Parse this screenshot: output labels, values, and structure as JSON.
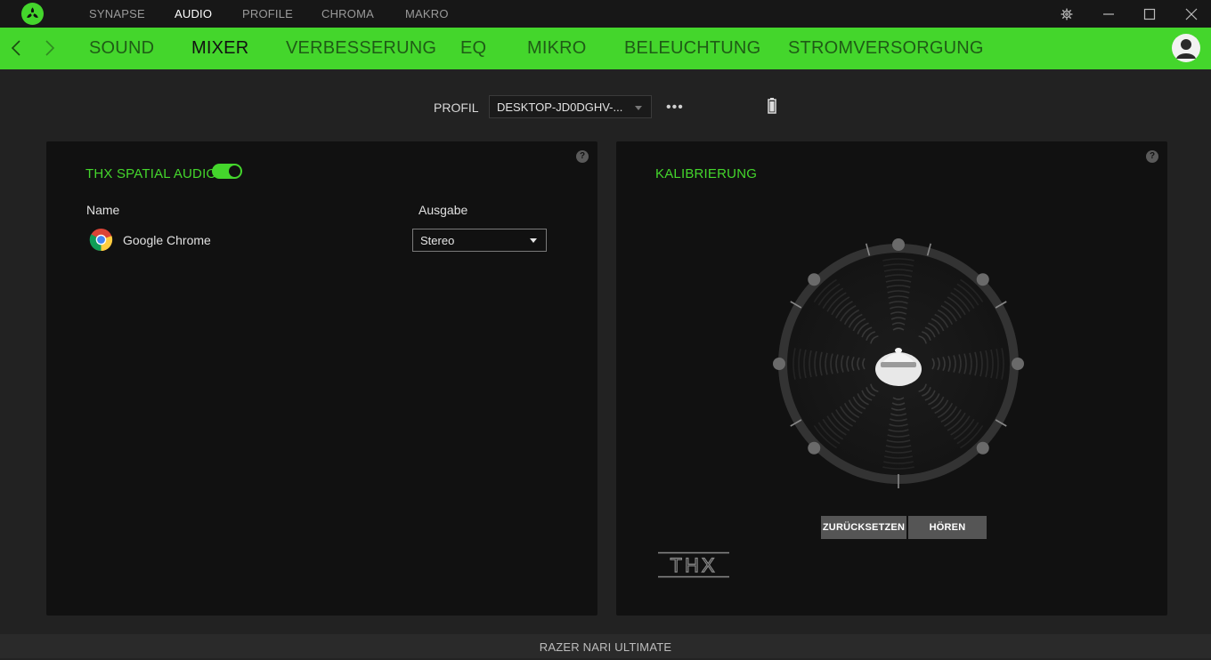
{
  "top_nav": {
    "items": [
      {
        "label": "SYNAPSE",
        "active": false
      },
      {
        "label": "AUDIO",
        "active": true
      },
      {
        "label": "PROFILE",
        "active": false
      },
      {
        "label": "CHROMA",
        "active": false
      },
      {
        "label": "MAKRO",
        "active": false
      }
    ]
  },
  "window_controls": [
    "gear-icon",
    "minimize-icon",
    "maximize-icon",
    "close-icon"
  ],
  "sub_nav": {
    "items": [
      {
        "label": "SOUND",
        "active": false
      },
      {
        "label": "MIXER",
        "active": true
      },
      {
        "label": "VERBESSERUNG",
        "active": false
      },
      {
        "label": "EQ",
        "active": false
      },
      {
        "label": "MIKRO",
        "active": false
      },
      {
        "label": "BELEUCHTUNG",
        "active": false
      },
      {
        "label": "STROMVERSORGUNG",
        "active": false
      }
    ]
  },
  "profile": {
    "label": "PROFIL",
    "selected": "DESKTOP-JD0DGHV-...",
    "more": "•••"
  },
  "mixer_panel": {
    "title": "THX SPATIAL AUDIO",
    "toggle_on": true,
    "help": "?",
    "columns": {
      "name": "Name",
      "output": "Ausgabe"
    },
    "rows": [
      {
        "app": "Google Chrome",
        "output": "Stereo"
      }
    ]
  },
  "calibration_panel": {
    "title": "KALIBRIERUNG",
    "help": "?",
    "reset_button": "ZURÜCKSETZEN",
    "listen_button": "HÖREN",
    "logo": "THX"
  },
  "footer": {
    "device": "RAZER NARI ULTIMATE"
  },
  "colors": {
    "accent": "#44d62c",
    "background": "#222222",
    "panel": "#111111",
    "titlebar": "#171717"
  }
}
